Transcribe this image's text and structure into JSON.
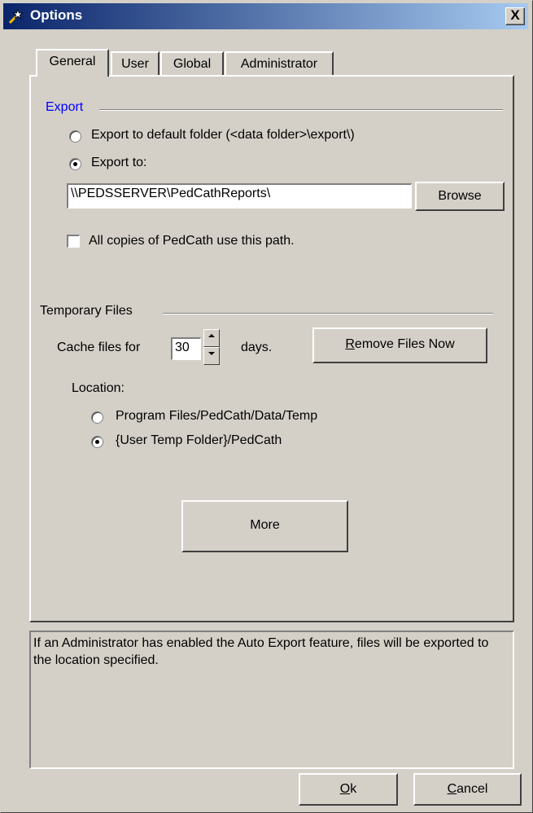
{
  "window": {
    "title": "Options",
    "close_label": "X"
  },
  "tabs": [
    {
      "label": "General",
      "active": true
    },
    {
      "label": "User",
      "active": false
    },
    {
      "label": "Global",
      "active": false
    },
    {
      "label": "Administrator",
      "active": false
    }
  ],
  "export": {
    "group_label": "Export",
    "label_color": "#0000ff",
    "default_folder_label": "Export to default folder (<data folder>\\export\\)",
    "default_folder_selected": false,
    "export_to_label": "Export to:",
    "export_to_selected": true,
    "path_value": "\\\\PEDSSERVER\\PedCathReports\\",
    "browse_label": "Browse",
    "all_copies_label": "All copies of PedCath use this path.",
    "all_copies_checked": false
  },
  "temp_files": {
    "group_label": "Temporary Files",
    "cache_prefix": "Cache files for",
    "cache_value": "30",
    "cache_suffix": "days.",
    "remove_button_label": "Remove Files Now",
    "location_label": "Location:",
    "location_options": [
      {
        "label": "Program Files/PedCath/Data/Temp",
        "selected": false
      },
      {
        "label": "{User Temp Folder}/PedCath",
        "selected": true
      }
    ]
  },
  "more_button_label": "More",
  "info_text": "If an Administrator has enabled the Auto Export feature, files will be exported to the location specified.",
  "footer": {
    "ok_label": "Ok",
    "cancel_label": "Cancel"
  },
  "colors": {
    "dialog_bg": "#d4d0c8",
    "title_start": "#0a246a",
    "title_end": "#a6caf0"
  }
}
